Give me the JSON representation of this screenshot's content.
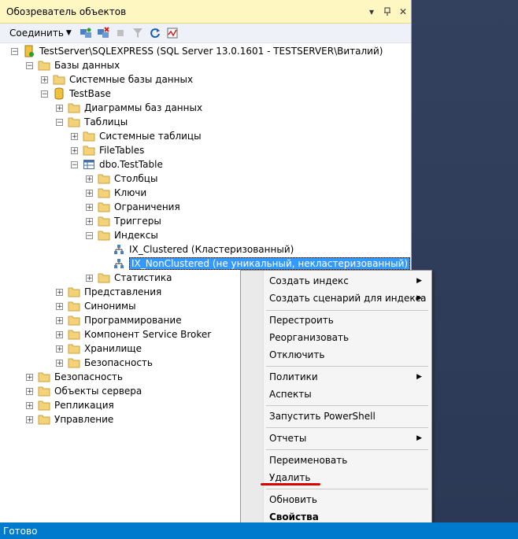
{
  "panel": {
    "title": "Обозреватель объектов"
  },
  "toolbar": {
    "connect_label": "Соединить"
  },
  "tree": {
    "server": "TestServer\\SQLEXPRESS (SQL Server 13.0.1601 - TESTSERVER\\Виталий)",
    "databases": "Базы данных",
    "system_databases": "Системные базы данных",
    "testbase": "TestBase",
    "diagrams": "Диаграммы баз данных",
    "tables": "Таблицы",
    "system_tables": "Системные таблицы",
    "filetables": "FileTables",
    "testtable": "dbo.TestTable",
    "columns": "Столбцы",
    "keys": "Ключи",
    "constraints": "Ограничения",
    "triggers": "Триггеры",
    "indexes": "Индексы",
    "ix_clustered": "IX_Clustered (Кластеризованный)",
    "ix_nonclustered": "IX_NonClustered (не уникальный, некластеризованный)",
    "statistics": "Статистика",
    "views": "Представления",
    "synonyms": "Синонимы",
    "programming": "Программирование",
    "service_broker": "Компонент Service Broker",
    "storage": "Хранилище",
    "db_security": "Безопасность",
    "security": "Безопасность",
    "server_objects": "Объекты сервера",
    "replication": "Репликация",
    "management": "Управление"
  },
  "context_menu": {
    "create_index": "Создать индекс",
    "script_index": "Создать сценарий для индекса",
    "rebuild": "Перестроить",
    "reorganize": "Реорганизовать",
    "disable": "Отключить",
    "policies": "Политики",
    "facets": "Аспекты",
    "powershell": "Запустить PowerShell",
    "reports": "Отчеты",
    "rename": "Переименовать",
    "delete": "Удалить",
    "refresh": "Обновить",
    "properties": "Свойства"
  },
  "status": {
    "text": "Готово"
  },
  "colors": {
    "accent": "#007acc",
    "selection": "#3399ff",
    "title_bg": "#fff7c2",
    "annotation": "#d90000"
  }
}
